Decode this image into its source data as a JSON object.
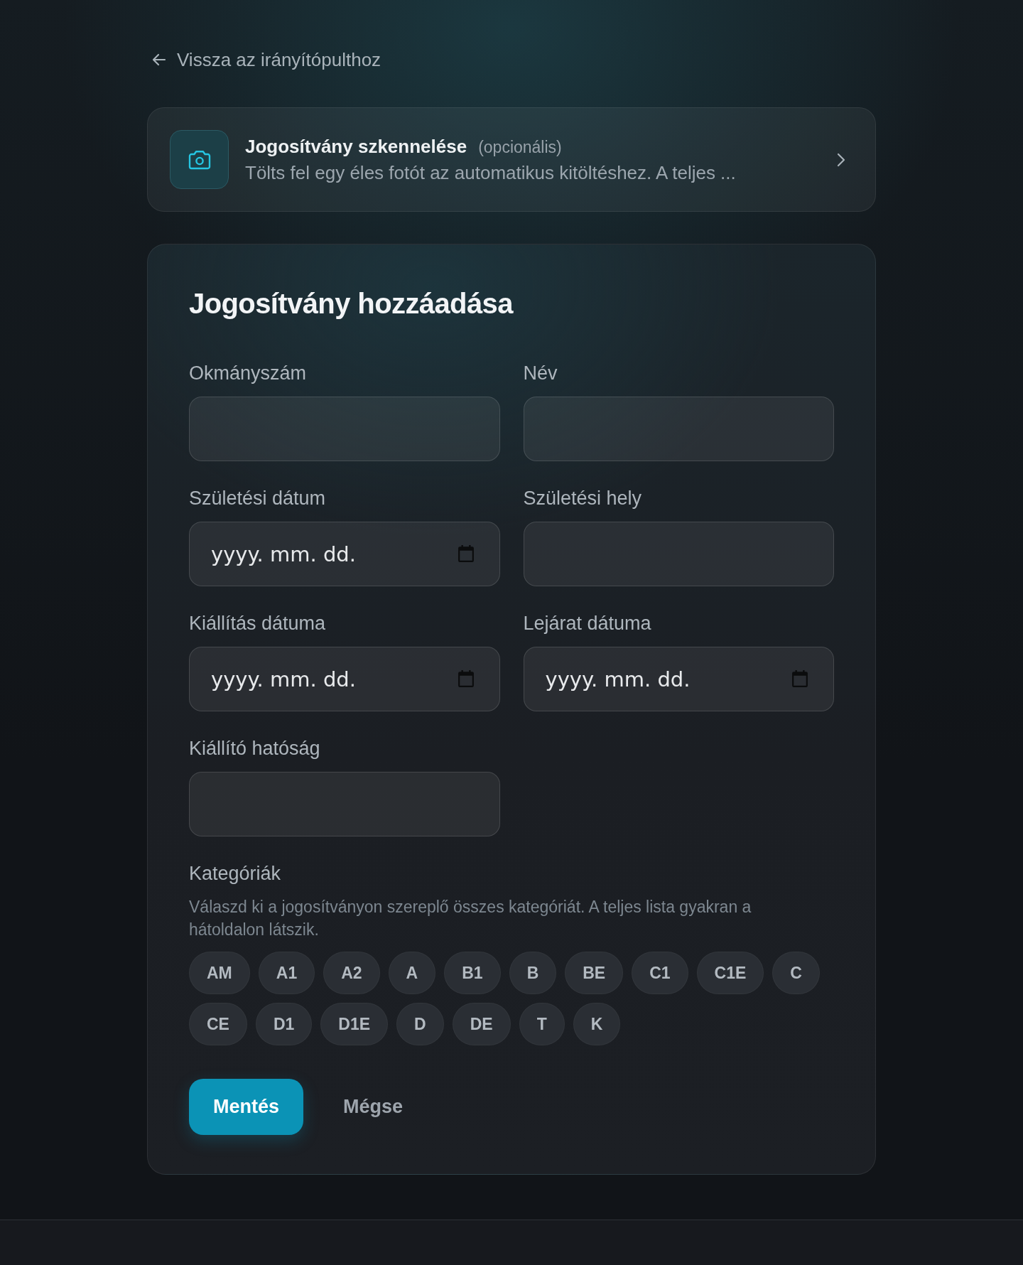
{
  "back_link": {
    "label": "Vissza az irányítópulthoz"
  },
  "scan_card": {
    "title": "Jogosítvány szkennelése",
    "tag": "(opcionális)",
    "description": "Tölts fel egy éles fotót az automatikus kitöltéshez. A teljes ..."
  },
  "form": {
    "title": "Jogosítvány hozzáadása",
    "fields": [
      {
        "label": "Okmányszám",
        "kind": "text"
      },
      {
        "label": "Név",
        "kind": "text"
      },
      {
        "label": "Születési dátum",
        "kind": "date",
        "placeholder": "yyyy. mm. dd."
      },
      {
        "label": "Születési hely",
        "kind": "text"
      },
      {
        "label": "Kiállítás dátuma",
        "kind": "date",
        "placeholder": "yyyy. mm. dd."
      },
      {
        "label": "Lejárat dátuma",
        "kind": "date",
        "placeholder": "yyyy. mm. dd."
      },
      {
        "label": "Kiállító hatóság",
        "kind": "text"
      }
    ],
    "categories": {
      "label": "Kategóriák",
      "help": "Válaszd ki a jogosítványon szereplő összes kategóriát. A teljes lista gyakran a hátoldalon látszik.",
      "options": [
        {
          "label": "AM",
          "selected": false
        },
        {
          "label": "A1",
          "selected": false
        },
        {
          "label": "A2",
          "selected": false
        },
        {
          "label": "A",
          "selected": false
        },
        {
          "label": "B1",
          "selected": false
        },
        {
          "label": "B",
          "selected": false
        },
        {
          "label": "BE",
          "selected": false
        },
        {
          "label": "C1",
          "selected": false
        },
        {
          "label": "C1E",
          "selected": false
        },
        {
          "label": "C",
          "selected": false
        },
        {
          "label": "CE",
          "selected": false
        },
        {
          "label": "D1",
          "selected": false
        },
        {
          "label": "D1E",
          "selected": false
        },
        {
          "label": "D",
          "selected": false
        },
        {
          "label": "DE",
          "selected": false
        },
        {
          "label": "T",
          "selected": false
        },
        {
          "label": "K",
          "selected": false
        }
      ]
    },
    "buttons": [
      {
        "label": "Mentés",
        "kind": "primary"
      },
      {
        "label": "Mégse",
        "kind": "secondary"
      }
    ]
  }
}
